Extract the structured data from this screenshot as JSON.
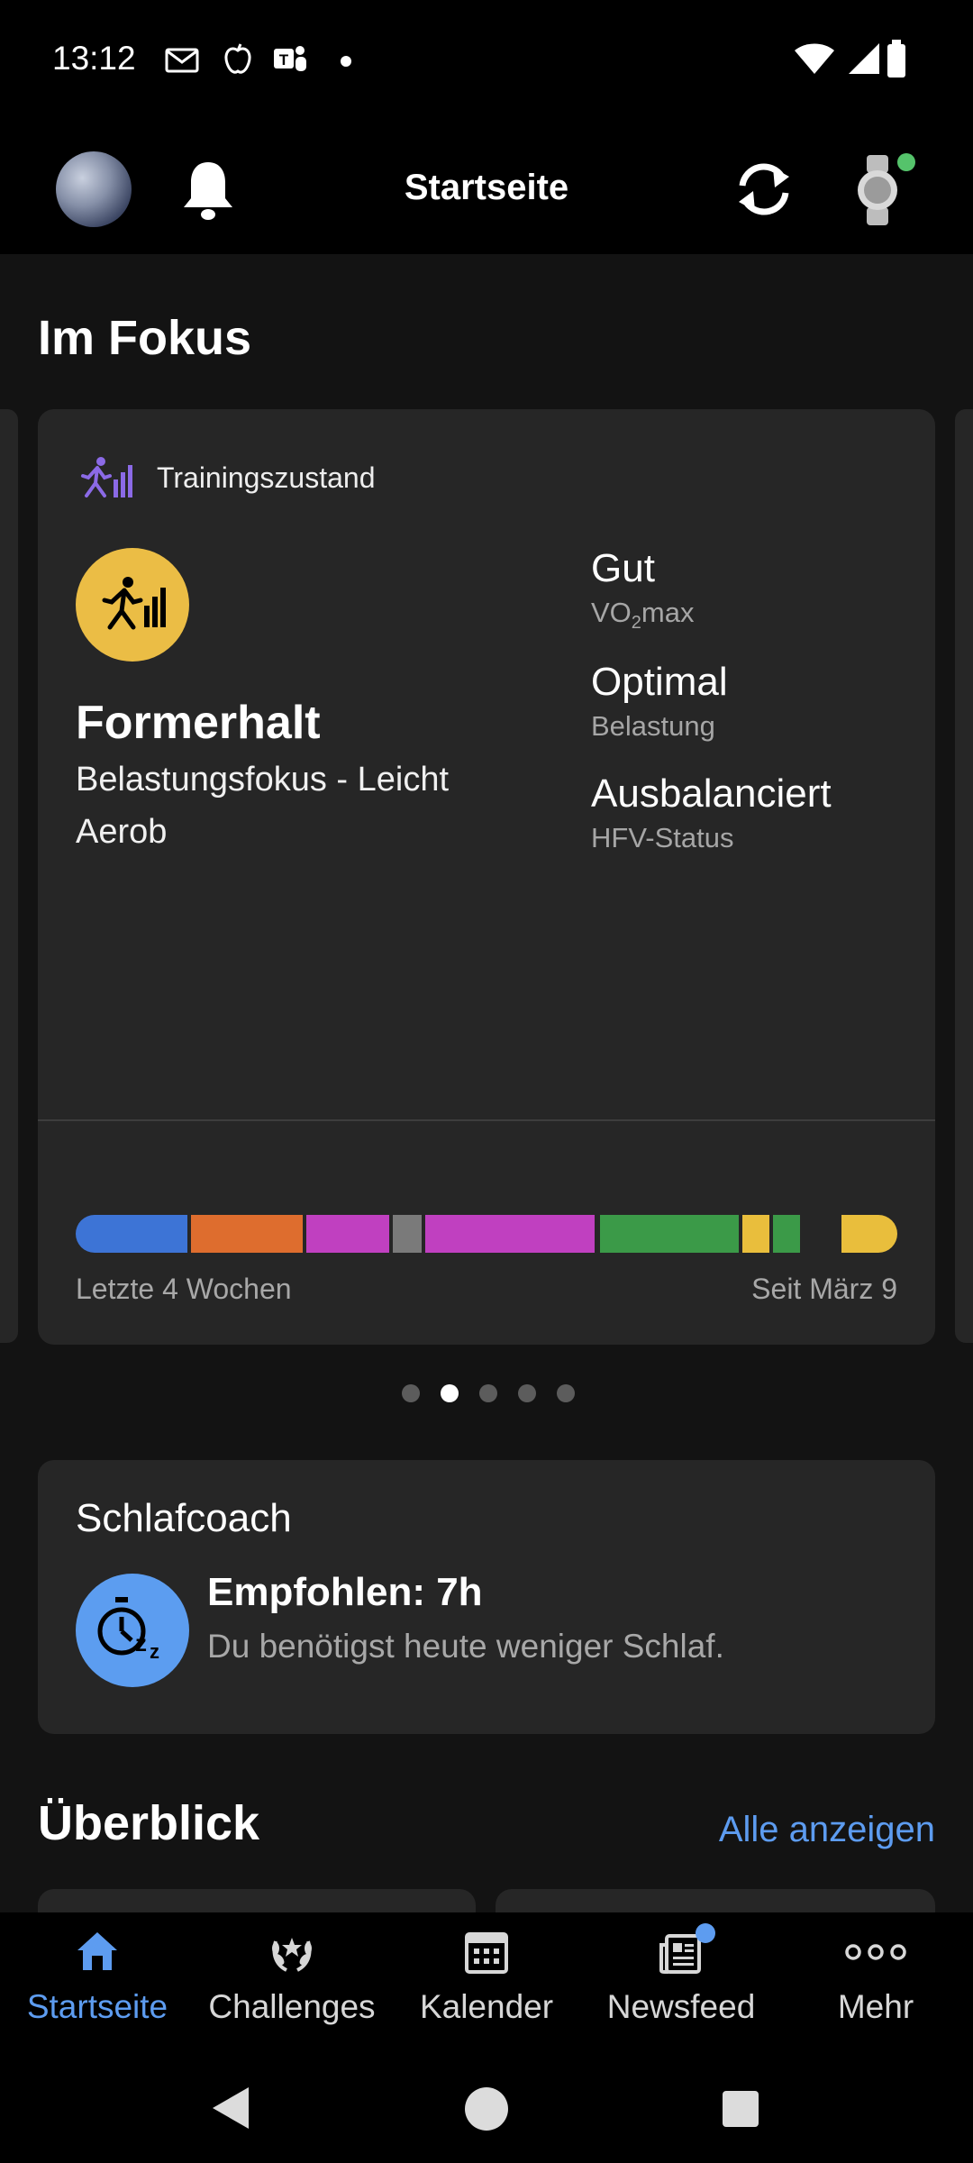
{
  "status_bar": {
    "time": "13:12",
    "icons_left": [
      "mail-icon",
      "fitness-app-icon",
      "teams-icon",
      "dot-icon"
    ],
    "icons_right": [
      "wifi-icon",
      "cell-signal-icon",
      "battery-icon"
    ]
  },
  "header": {
    "title": "Startseite",
    "left_icons": [
      "avatar",
      "bell-icon"
    ],
    "right_icons": [
      "sync-icon",
      "watch-icon"
    ],
    "watch_connected_color": "#55c36b"
  },
  "focus": {
    "section_title": "Im Fokus",
    "card": {
      "title": "Trainingszustand",
      "status": "Formerhalt",
      "subtitle": "Belastungsfokus - Leicht Aerob",
      "metrics": [
        {
          "value": "Gut",
          "label_prefix": "VO",
          "label_sub": "2",
          "label_suffix": "max"
        },
        {
          "value": "Optimal",
          "label": "Belastung"
        },
        {
          "value": "Ausbalanciert",
          "label": "HFV-Status"
        }
      ],
      "history_colors": [
        "#3d74d6",
        "#de6d2e",
        "#c040c0",
        "#7a7a7a",
        "#c040c0",
        "#3b9a48",
        "#e9be3c",
        "#3b9a48",
        "#e9be3c"
      ],
      "caption_left": "Letzte 4 Wochen",
      "caption_right": "Seit März 9"
    },
    "pager": {
      "count": 5,
      "active_index": 1
    }
  },
  "sleep": {
    "title": "Schlafcoach",
    "headline": "Empfohlen: 7h",
    "text": "Du benötigst heute weniger Schlaf."
  },
  "overview": {
    "title": "Überblick",
    "link": "Alle anzeigen"
  },
  "bottom_nav": {
    "items": [
      {
        "label": "Startseite",
        "icon": "home-icon",
        "active": true
      },
      {
        "label": "Challenges",
        "icon": "laurel-icon",
        "active": false
      },
      {
        "label": "Kalender",
        "icon": "calendar-icon",
        "active": false
      },
      {
        "label": "Newsfeed",
        "icon": "newsfeed-icon",
        "active": false,
        "badge": true
      },
      {
        "label": "Mehr",
        "icon": "more-icon",
        "active": false
      }
    ],
    "accent": "#5d9cf0"
  },
  "system_nav": [
    "back-button",
    "home-button",
    "recents-button"
  ]
}
